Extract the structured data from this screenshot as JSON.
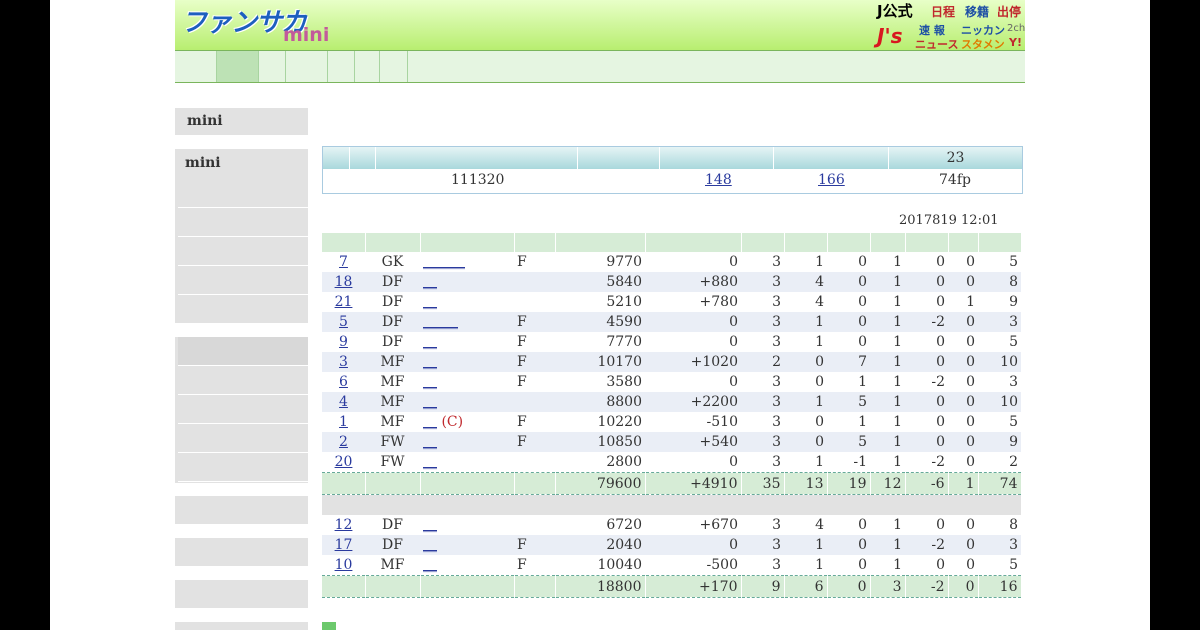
{
  "brand": {
    "logo_main": "ファンサカ",
    "logo_sub": "mini"
  },
  "header_links": {
    "j_official": "J公式",
    "nikkei": "日程",
    "transfer": "移籍",
    "suspension": "出停",
    "js_logo": "J's",
    "speed": "速 報",
    "news": "ニュース",
    "nikkan": "ニッカン",
    "twoch": "2ch",
    "lineup": "スタメン",
    "yahoo": "Y!"
  },
  "sidebar": {
    "box1_title": "mini",
    "box2_title": "mini"
  },
  "ranking": {
    "last_header": "23",
    "score": "111320",
    "link1": "148",
    "link2": "166",
    "fp": "74fp"
  },
  "timestamp": "2017819 12:01",
  "starters": [
    {
      "no": "7",
      "pos": "GK",
      "name": "______",
      "flag": "F",
      "price": "9770",
      "diff": "0",
      "a": "3",
      "b": "1",
      "c": "0",
      "d": "1",
      "e": "0",
      "f": "0",
      "g": "5"
    },
    {
      "no": "18",
      "pos": "DF",
      "name": "__",
      "flag": "",
      "price": "5840",
      "diff": "+880",
      "a": "3",
      "b": "4",
      "c": "0",
      "d": "1",
      "e": "0",
      "f": "0",
      "g": "8"
    },
    {
      "no": "21",
      "pos": "DF",
      "name": "__",
      "flag": "",
      "price": "5210",
      "diff": "+780",
      "a": "3",
      "b": "4",
      "c": "0",
      "d": "1",
      "e": "0",
      "f": "1",
      "g": "9"
    },
    {
      "no": "5",
      "pos": "DF",
      "name": "_____",
      "flag": "F",
      "price": "4590",
      "diff": "0",
      "a": "3",
      "b": "1",
      "c": "0",
      "d": "1",
      "e": "-2",
      "f": "0",
      "g": "3"
    },
    {
      "no": "9",
      "pos": "DF",
      "name": "__",
      "flag": "F",
      "price": "7770",
      "diff": "0",
      "a": "3",
      "b": "1",
      "c": "0",
      "d": "1",
      "e": "0",
      "f": "0",
      "g": "5"
    },
    {
      "no": "3",
      "pos": "MF",
      "name": "__",
      "flag": "F",
      "price": "10170",
      "diff": "+1020",
      "a": "2",
      "b": "0",
      "c": "7",
      "d": "1",
      "e": "0",
      "f": "0",
      "g": "10"
    },
    {
      "no": "6",
      "pos": "MF",
      "name": "__",
      "flag": "F",
      "price": "3580",
      "diff": "0",
      "a": "3",
      "b": "0",
      "c": "1",
      "d": "1",
      "e": "-2",
      "f": "0",
      "g": "3"
    },
    {
      "no": "4",
      "pos": "MF",
      "name": "__",
      "flag": "",
      "price": "8800",
      "diff": "+2200",
      "a": "3",
      "b": "1",
      "c": "5",
      "d": "1",
      "e": "0",
      "f": "0",
      "g": "10"
    },
    {
      "no": "1",
      "pos": "MF",
      "name": "__",
      "cap": "(C)",
      "flag": "F",
      "price": "10220",
      "diff": "-510",
      "a": "3",
      "b": "0",
      "c": "1",
      "d": "1",
      "e": "0",
      "f": "0",
      "g": "5"
    },
    {
      "no": "2",
      "pos": "FW",
      "name": "__",
      "flag": "F",
      "price": "10850",
      "diff": "+540",
      "a": "3",
      "b": "0",
      "c": "5",
      "d": "1",
      "e": "0",
      "f": "0",
      "g": "9"
    },
    {
      "no": "20",
      "pos": "FW",
      "name": "__",
      "flag": "",
      "price": "2800",
      "diff": "0",
      "a": "3",
      "b": "1",
      "c": "-1",
      "d": "1",
      "e": "-2",
      "f": "0",
      "g": "2"
    }
  ],
  "starters_total": {
    "price": "79600",
    "diff": "+4910",
    "a": "35",
    "b": "13",
    "c": "19",
    "d": "12",
    "e": "-6",
    "f": "1",
    "g": "74"
  },
  "subs": [
    {
      "no": "12",
      "pos": "DF",
      "name": "__",
      "flag": "",
      "price": "6720",
      "diff": "+670",
      "a": "3",
      "b": "4",
      "c": "0",
      "d": "1",
      "e": "0",
      "f": "0",
      "g": "8"
    },
    {
      "no": "17",
      "pos": "DF",
      "name": "__",
      "flag": "F",
      "price": "2040",
      "diff": "0",
      "a": "3",
      "b": "1",
      "c": "0",
      "d": "1",
      "e": "-2",
      "f": "0",
      "g": "3"
    },
    {
      "no": "10",
      "pos": "MF",
      "name": "__",
      "flag": "F",
      "price": "10040",
      "diff": "-500",
      "a": "3",
      "b": "1",
      "c": "0",
      "d": "1",
      "e": "0",
      "f": "0",
      "g": "5"
    }
  ],
  "subs_total": {
    "price": "18800",
    "diff": "+170",
    "a": "9",
    "b": "6",
    "c": "0",
    "d": "3",
    "e": "-2",
    "f": "0",
    "g": "16"
  }
}
